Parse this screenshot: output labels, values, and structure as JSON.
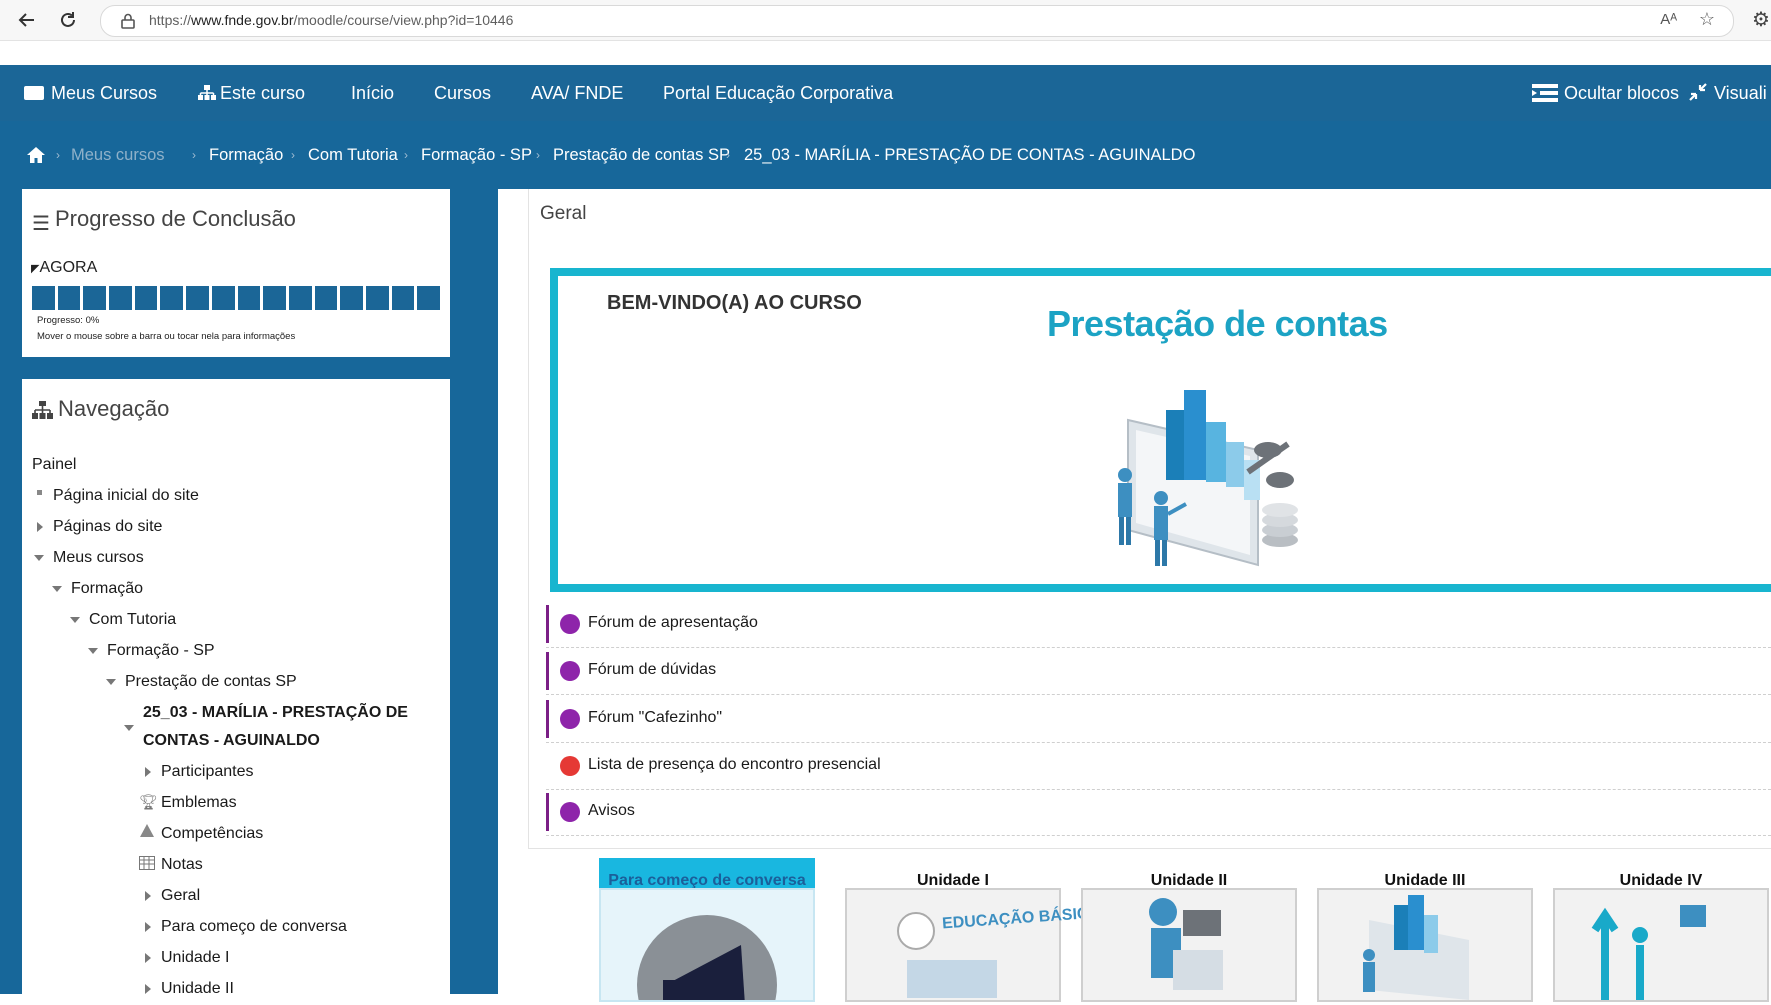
{
  "browser": {
    "url_prefix": "https://",
    "url_domain": "www.fnde.gov.br",
    "url_path": "/moodle/course/view.php?id=10446"
  },
  "menu": {
    "items": [
      "Meus Cursos",
      "Este curso",
      "Início",
      "Cursos",
      "AVA/ FNDE",
      "Portal Educação Corporativa"
    ],
    "right_hide": "Ocultar blocos",
    "right_view": "Visuali"
  },
  "breadcrumb": [
    "Meus cursos",
    "Formação",
    "Com Tutoria",
    "Formação - SP",
    "Prestação de contas SP",
    "25_03 - MARÍLIA - PRESTAÇÃO DE CONTAS - AGUINALDO"
  ],
  "progress_block": {
    "title": "Progresso de Conclusão",
    "now_label": "AGORA",
    "progress_label": "Progresso: 0%",
    "progress_value": 0,
    "hint": "Mover o mouse sobre a barra ou tocar nela para informações"
  },
  "nav_block": {
    "title": "Navegação",
    "items": [
      "Painel",
      "Página inicial do site",
      "Páginas do site",
      "Meus cursos",
      "Formação",
      "Com Tutoria",
      "Formação - SP",
      "Prestação de contas SP",
      "25_03 - MARÍLIA - PRESTAÇÃO DE",
      "CONTAS - AGUINALDO",
      "Participantes",
      "Emblemas",
      "Competências",
      "Notas",
      "Geral",
      "Para começo de conversa",
      "Unidade I",
      "Unidade II"
    ]
  },
  "main": {
    "section_title": "Geral",
    "banner_welcome": "BEM-VINDO(A) AO CURSO",
    "banner_title": "Prestação de contas",
    "activities": [
      "Fórum de apresentação",
      "Fórum de dúvidas",
      "Fórum \"Cafezinho\"",
      "Lista de presença do encontro presencial",
      "Avisos"
    ],
    "tiles": [
      "Para começo de conversa",
      "Unidade I",
      "Unidade II",
      "Unidade III",
      "Unidade IV"
    ],
    "tile1_image_text": "EDUCAÇÃO BÁSICA"
  },
  "colors": {
    "primary_blue": "#1b6697",
    "banner_cyan": "#18b5cf",
    "forum_purple": "#8e24aa",
    "attendance_red": "#e53935",
    "tile_highlight": "#19b7e0"
  }
}
